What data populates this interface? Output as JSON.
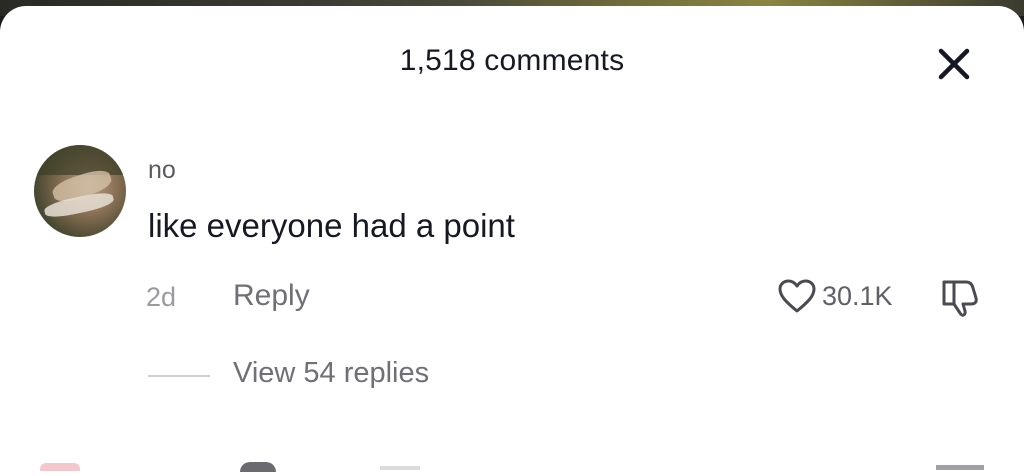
{
  "sheet": {
    "title": "1,518 comments"
  },
  "comment": {
    "username": "no",
    "text": "like everyone had a point",
    "time": "2d",
    "reply_label": "Reply",
    "likes": "30.1K",
    "view_replies_label": "View 54 replies"
  },
  "icons": {
    "close": "close-icon",
    "like": "heart-icon",
    "dislike": "thumbs-down-icon"
  }
}
